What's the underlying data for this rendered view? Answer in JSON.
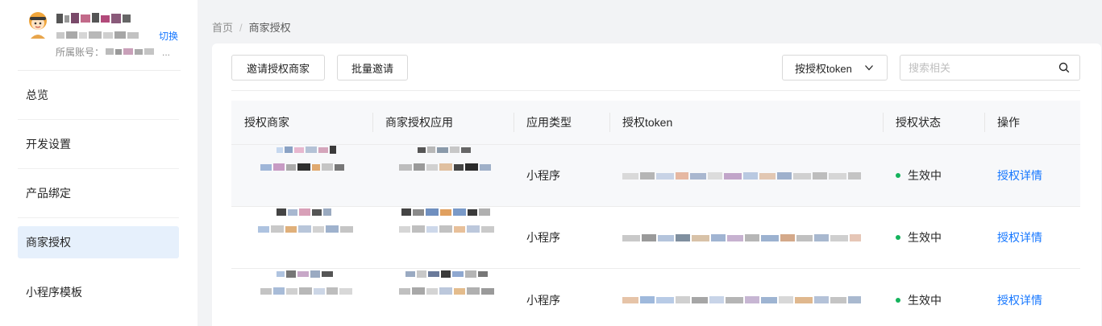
{
  "colors": {
    "accent": "#1677ff",
    "active_nav_bg": "#e6f0fc",
    "status_green": "#14b35c"
  },
  "account": {
    "name": "",
    "id": "",
    "switch_label": "切换",
    "belong_label": "所属账号：",
    "belong_suffix": "..."
  },
  "nav": {
    "items": [
      {
        "label": "总览"
      },
      {
        "label": "开发设置"
      },
      {
        "label": "产品绑定"
      },
      {
        "label": "商家授权",
        "active": true
      },
      {
        "label": "小程序模板"
      }
    ]
  },
  "breadcrumb": {
    "home": "首页",
    "separator": "/",
    "current": "商家授权"
  },
  "toolbar": {
    "invite_label": "邀请授权商家",
    "batch_invite_label": "批量邀请",
    "filter_label": "按授权token",
    "search_placeholder": "搜索相关"
  },
  "table": {
    "columns": [
      "授权商家",
      "商家授权应用",
      "应用类型",
      "授权token",
      "授权状态",
      "操作"
    ],
    "rows": [
      {
        "app_type": "小程序",
        "status": "生效中",
        "action": "授权详情"
      },
      {
        "app_type": "小程序",
        "status": "生效中",
        "action": "授权详情"
      },
      {
        "app_type": "小程序",
        "status": "生效中",
        "action": "授权详情"
      }
    ]
  }
}
